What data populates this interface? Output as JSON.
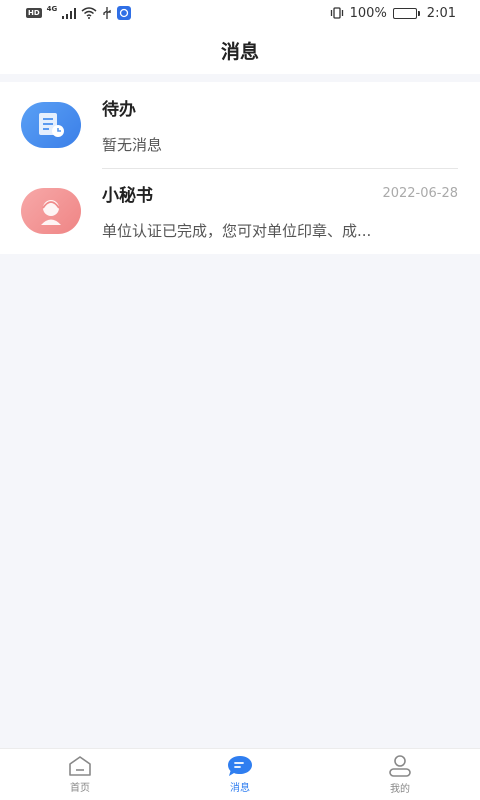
{
  "status_bar": {
    "hd": "HD",
    "network": "4G",
    "battery": "100%",
    "time": "2:01"
  },
  "header": {
    "title": "消息"
  },
  "messages": [
    {
      "title": "待办",
      "preview": "暂无消息",
      "date": "",
      "icon": "todo-icon"
    },
    {
      "title": "小秘书",
      "preview": "单位认证已完成，您可对单位印章、成...",
      "date": "2022-06-28",
      "icon": "assistant-avatar-icon"
    }
  ],
  "tabs": [
    {
      "label": "首页",
      "icon": "home-icon",
      "active": false
    },
    {
      "label": "消息",
      "icon": "message-icon",
      "active": true
    },
    {
      "label": "我的",
      "icon": "profile-icon",
      "active": false
    }
  ],
  "colors": {
    "accent": "#2f7ef0",
    "background": "#f5f6fa"
  }
}
